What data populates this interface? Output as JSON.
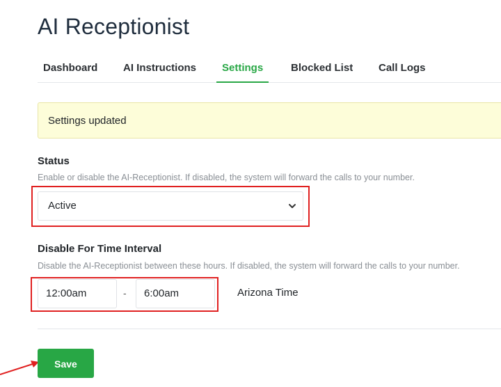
{
  "page": {
    "title": "AI Receptionist"
  },
  "tabs": [
    {
      "label": "Dashboard",
      "active": false
    },
    {
      "label": "AI Instructions",
      "active": false
    },
    {
      "label": "Settings",
      "active": true
    },
    {
      "label": "Blocked List",
      "active": false
    },
    {
      "label": "Call Logs",
      "active": false
    }
  ],
  "alert": {
    "message": "Settings updated"
  },
  "status": {
    "label": "Status",
    "help": "Enable or disable the AI-Receptionist. If disabled, the system will forward the calls to your number.",
    "value": "Active",
    "icon": "chevron-down-icon"
  },
  "interval": {
    "label": "Disable For Time Interval",
    "help": "Disable the AI-Receptionist between these hours. If disabled, the system will forward the calls to your number.",
    "start": "12:00am",
    "separator": "-",
    "end": "6:00am",
    "timezone": "Arizona Time"
  },
  "actions": {
    "save_label": "Save"
  },
  "colors": {
    "accent": "#28a745",
    "highlight": "#e02020",
    "alert_bg": "#fdfdd9"
  }
}
